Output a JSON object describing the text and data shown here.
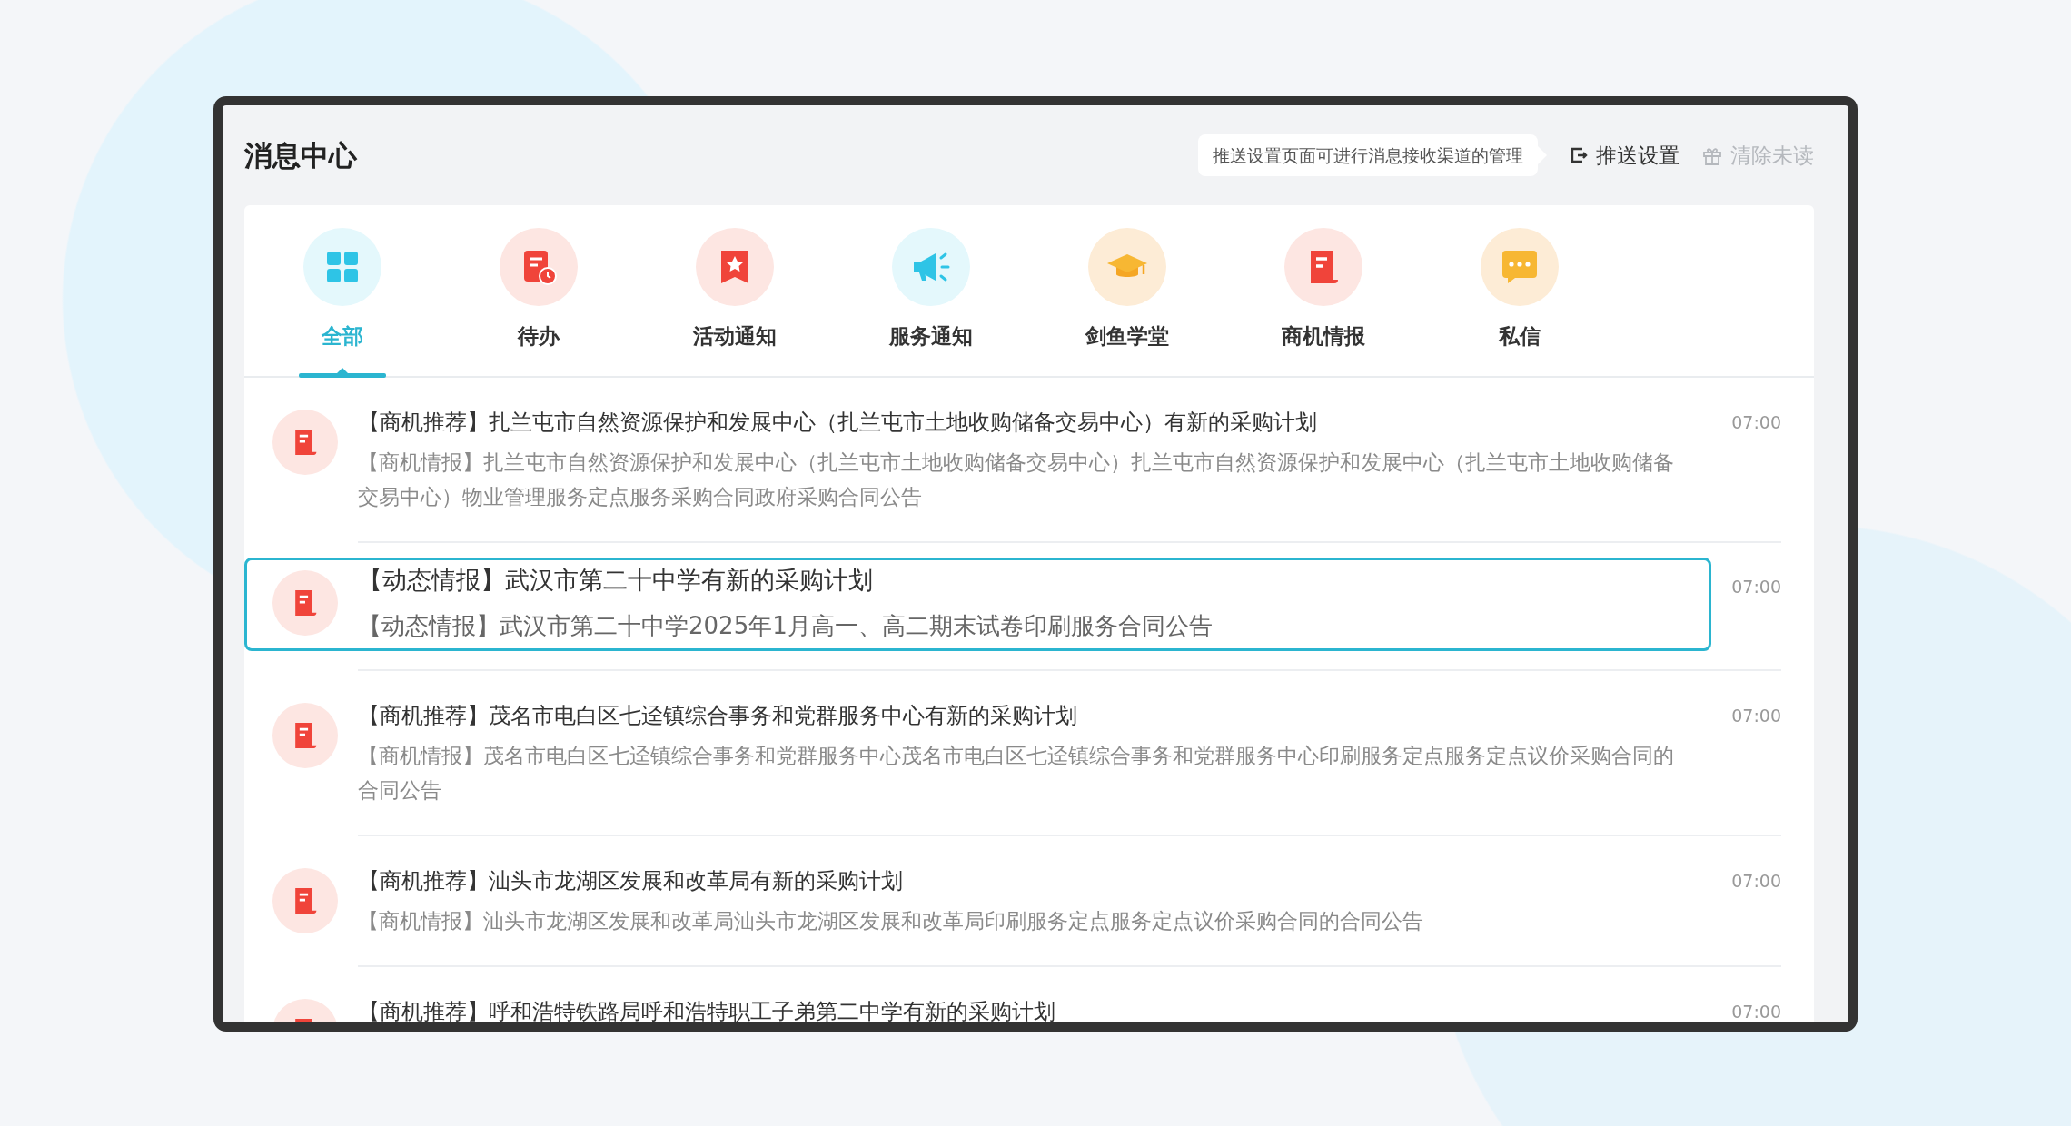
{
  "window": {
    "title": "消息中心"
  },
  "header": {
    "hint": "推送设置页面可进行消息接收渠道的管理",
    "push_settings": "推送设置",
    "clear_unread": {
      "label": "清除未读",
      "disabled": true
    }
  },
  "tabs": [
    {
      "label": "全部",
      "selected": true
    },
    {
      "label": "待办",
      "selected": false
    },
    {
      "label": "活动通知",
      "selected": false
    },
    {
      "label": "服务通知",
      "selected": false
    },
    {
      "label": "剑鱼学堂",
      "selected": false
    },
    {
      "label": "商机情报",
      "selected": false
    },
    {
      "label": "私信",
      "selected": false
    }
  ],
  "messages": [
    {
      "title": "【商机推荐】扎兰屯市自然资源保护和发展中心（扎兰屯市土地收购储备交易中心）有新的采购计划",
      "body": "【商机情报】扎兰屯市自然资源保护和发展中心（扎兰屯市土地收购储备交易中心）扎兰屯市自然资源保护和发展中心（扎兰屯市土地收购储备交易中心）物业管理服务定点服务采购合同政府采购合同公告",
      "time": "07:00",
      "selected": false
    },
    {
      "title": "【动态情报】武汉市第二十中学有新的采购计划",
      "body": "【动态情报】武汉市第二十中学2025年1月高一、高二期末试卷印刷服务合同公告",
      "time": "07:00",
      "selected": true
    },
    {
      "title": "【商机推荐】茂名市电白区七迳镇综合事务和党群服务中心有新的采购计划",
      "body": "【商机情报】茂名市电白区七迳镇综合事务和党群服务中心茂名市电白区七迳镇综合事务和党群服务中心印刷服务定点服务定点议价采购合同的合同公告",
      "time": "07:00",
      "selected": false
    },
    {
      "title": "【商机推荐】汕头市龙湖区发展和改革局有新的采购计划",
      "body": "【商机情报】汕头市龙湖区发展和改革局汕头市龙湖区发展和改革局印刷服务定点服务定点议价采购合同的合同公告",
      "time": "07:00",
      "selected": false
    },
    {
      "title": "【商机推荐】呼和浩特铁路局呼和浩特职工子弟第二中学有新的采购计划",
      "time": "07:00",
      "selected": false
    }
  ]
}
